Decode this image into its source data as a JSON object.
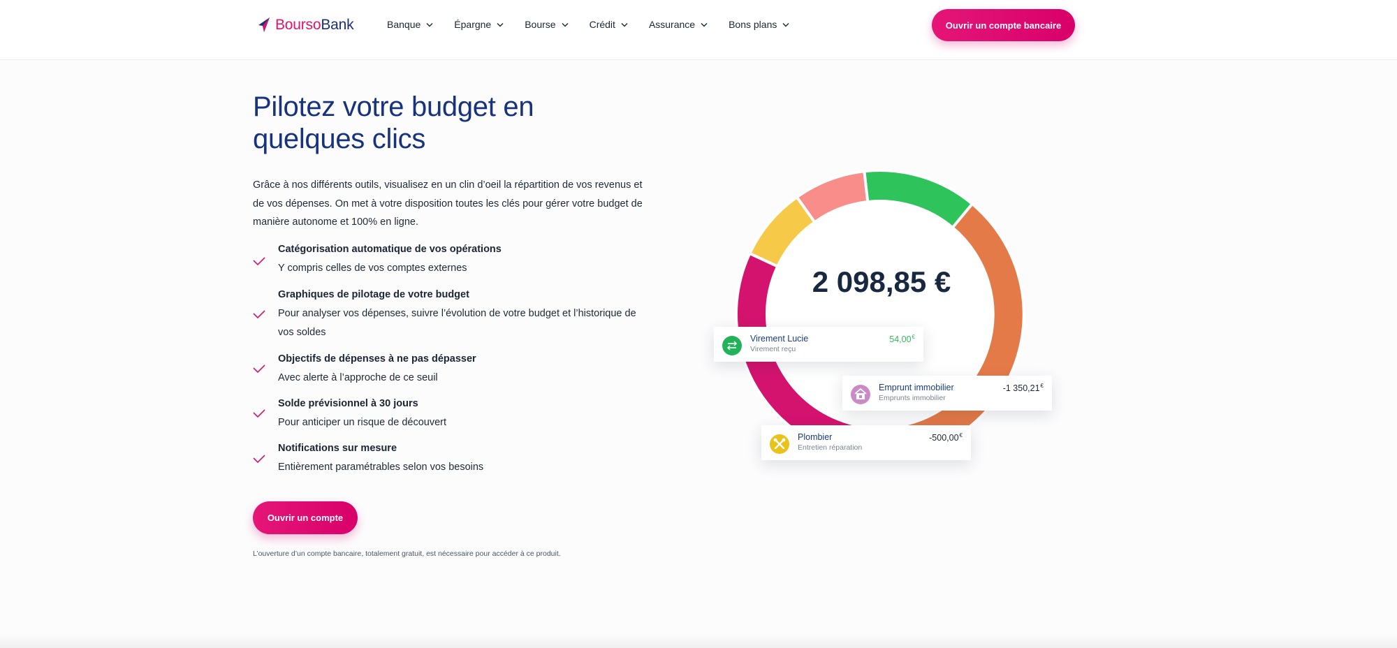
{
  "header": {
    "logo": {
      "part1": "Bourso",
      "part2": "Bank"
    },
    "nav": [
      {
        "label": "Banque",
        "name": "nav-banque"
      },
      {
        "label": "Épargne",
        "name": "nav-epargne"
      },
      {
        "label": "Bourse",
        "name": "nav-bourse"
      },
      {
        "label": "Crédit",
        "name": "nav-credit"
      },
      {
        "label": "Assurance",
        "name": "nav-assurance"
      },
      {
        "label": "Bons plans",
        "name": "nav-bons-plans"
      }
    ],
    "cta": "Ouvrir un compte bancaire"
  },
  "main": {
    "title": "Pilotez votre budget en quelques clics",
    "intro": "Grâce à nos différents outils, visualisez en un clin d’oeil la répartition de vos revenus et de vos dépenses. On met à votre disposition toutes les clés pour gérer votre budget de manière autonome et 100% en ligne.",
    "features": [
      {
        "title": "Catégorisation automatique de vos opérations",
        "desc": "Y compris celles de vos comptes externes"
      },
      {
        "title": "Graphiques de pilotage de votre budget",
        "desc": "Pour analyser vos dépenses, suivre l’évolution de votre budget et l’historique de vos soldes"
      },
      {
        "title": "Objectifs de dépenses à ne pas dépasser",
        "desc": "Avec alerte à l’approche de ce seuil"
      },
      {
        "title": "Solde prévisionnel à 30 jours",
        "desc": "Pour anticiper un risque de découvert"
      },
      {
        "title": "Notifications sur mesure",
        "desc": "Entièrement paramétrables selon vos besoins"
      }
    ],
    "cta": "Ouvrir un compte",
    "legal": "L’ouverture d’un compte bancaire, totalement gratuit, est nécessaire pour accéder à ce produit."
  },
  "visual": {
    "balance": "2 098,85 €",
    "segments": [
      {
        "label": "green",
        "color": "#2fc35c"
      },
      {
        "label": "orange",
        "color": "#e47a48"
      },
      {
        "label": "magenta",
        "color": "#d4136f"
      },
      {
        "label": "yellow",
        "color": "#f7c948"
      },
      {
        "label": "salmon",
        "color": "#f98d8a"
      }
    ],
    "transactions": [
      {
        "name": "Virement Lucie",
        "sub": "Virement reçu",
        "amount": "54,00",
        "currency": "€",
        "icon": "transfer-icon",
        "amount_color": "#35b85d"
      },
      {
        "name": "Emprunt immobilier",
        "sub": "Emprunts immobilier",
        "amount": "-1 350,21",
        "currency": "€",
        "icon": "house-loan-icon",
        "amount_color": "#1b2535"
      },
      {
        "name": "Plombier",
        "sub": "Entretien réparation",
        "amount": "-500,00",
        "currency": "€",
        "icon": "tools-icon",
        "amount_color": "#1b2535"
      }
    ]
  }
}
